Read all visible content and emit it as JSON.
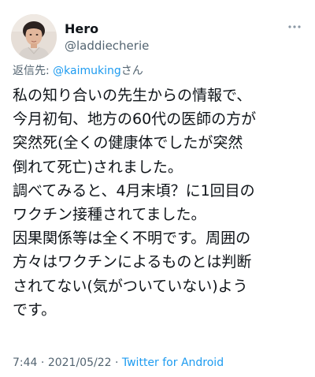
{
  "user": {
    "display_name": "Hero",
    "handle": "@laddiecherie"
  },
  "reply": {
    "prefix": "返信先: ",
    "mention": "@kaimuking",
    "suffix": "さん"
  },
  "tweet_lines": [
    "私の知り合いの先生からの情報で、",
    "今月初旬、地方の60代の医師の方が",
    "突然死(全くの健康体でしたが突然",
    "倒れて死亡)されました。",
    "調べてみると、4月末頃？に1回目の",
    "ワクチン接種されてました。",
    "因果関係等は全く不明です。周囲の",
    "方々はワクチンによるものとは判断",
    "されてない(気がついていない)よう",
    "です。"
  ],
  "meta": {
    "time": "7:44",
    "separator": " · ",
    "date": "2021/05/22",
    "source": "Twitter for Android"
  },
  "icons": {
    "avatar": "profile-photo",
    "more": "more-horizontal-icon"
  },
  "colors": {
    "link": "#1d9bf0",
    "secondary_text": "#536471",
    "primary_text": "#0f1419"
  }
}
